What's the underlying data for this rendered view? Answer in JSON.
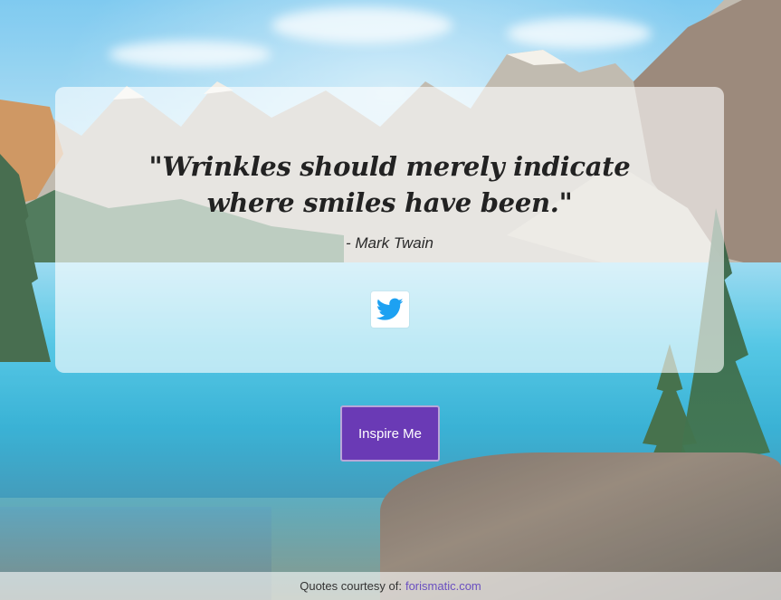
{
  "quote": {
    "text": "\"Wrinkles should merely indicate where smiles have been.\"",
    "author": "- Mark Twain"
  },
  "tweet_button": {
    "icon": "twitter-bird-icon",
    "color": "#1da1f2"
  },
  "inspire_button": {
    "label": "Inspire Me",
    "color": "#6a3ab5"
  },
  "footer": {
    "credit_text": "Quotes courtesy of:",
    "link_text": "forismatic.com",
    "link_color": "#6a4fc0"
  }
}
